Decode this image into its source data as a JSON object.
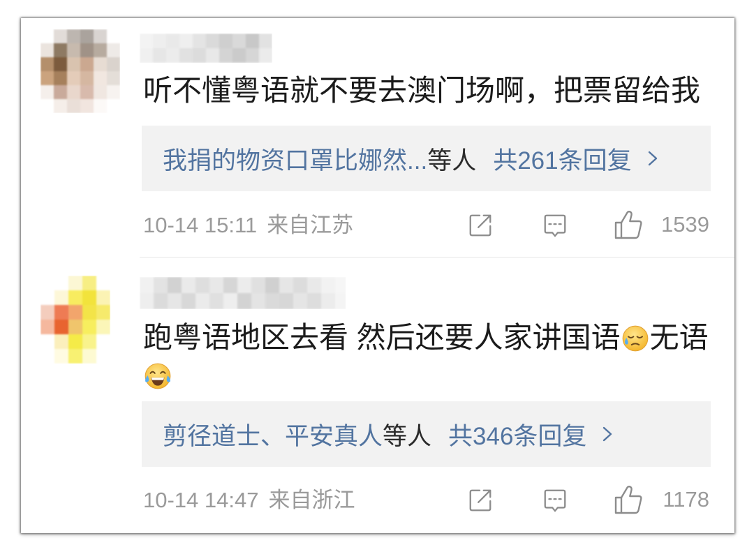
{
  "comments": [
    {
      "body": "听不懂粤语就不要去澳门场啊，把票留给我",
      "reply_names": "我捐的物资口罩比娜然...",
      "reply_suffix": "等人",
      "reply_count": "共261条回复",
      "time": "10-14 15:11",
      "location": "来自江苏",
      "likes": "1539"
    },
    {
      "body": "跑粤语地区去看 然后还要人家讲国语",
      "body_emoji": "sweat-emoji",
      "body_after": "无语",
      "body_line2_emoji": "laugh-cry-emoji",
      "reply_names": "剪径道士、平安真人",
      "reply_suffix": "等人",
      "reply_count": "共346条回复",
      "time": "10-14 14:47",
      "location": "来自浙江",
      "likes": "1178"
    }
  ],
  "icons": {
    "share": "share-icon",
    "comment": "comment-icon",
    "like": "like-icon",
    "reply_more": "chevron-right-icon"
  },
  "colors": {
    "text": "#1b1b1b",
    "meta": "#9a9a9a",
    "link": "#5274a0",
    "reply-bg": "#f2f2f2",
    "icon": "#8c8c8c",
    "divider": "#e6e6e6"
  }
}
